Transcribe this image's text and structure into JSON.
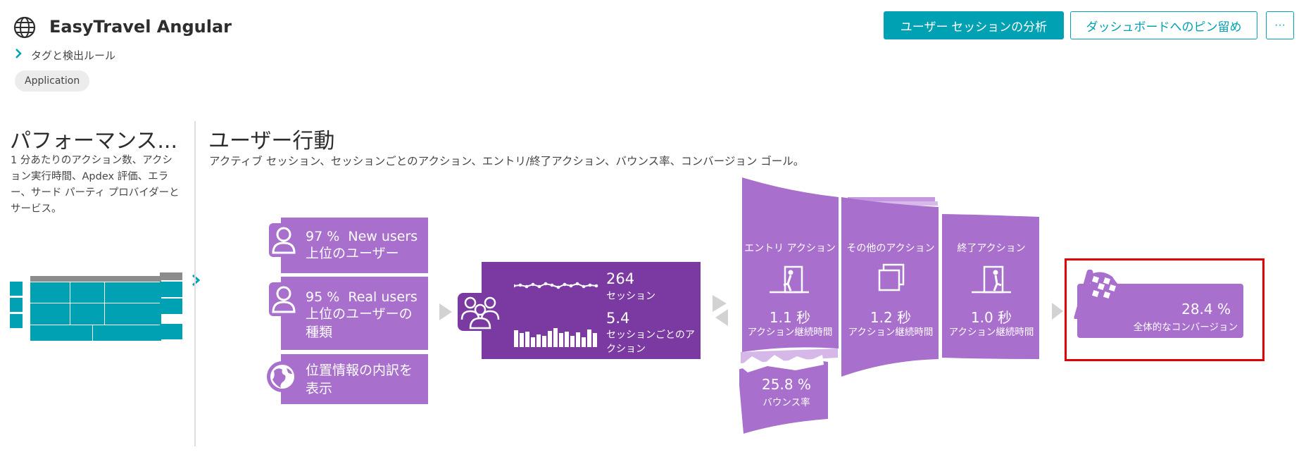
{
  "header": {
    "app_title": "EasyTravel Angular",
    "breadcrumb": "タグと検出ルール",
    "tag": "Application",
    "buttons": {
      "analyze": "ユーザー セッションの分析",
      "pin": "ダッシュボードへのピン留め",
      "more": "···"
    }
  },
  "performance": {
    "title": "パフォーマンス...",
    "description": "1 分あたりのアクション数、アクション実行時間、Apdex 評価、エラー、サード パーティ プロバイダーとサービス。"
  },
  "user_behavior": {
    "title": "ユーザー行動",
    "description": "アクティブ セッション、セッションごとのアクション、エントリ/終了アクション、バウンス率、コンバージョン ゴール。",
    "new_users": {
      "value": "97 %",
      "type": "New users",
      "label": "上位のユーザー"
    },
    "real_users": {
      "value": "95 %",
      "type": "Real users",
      "label": "上位のユーザーの種類"
    },
    "geo": {
      "label": "位置情報の内訳を表示"
    },
    "sessions": {
      "value": "264",
      "label": "セッション"
    },
    "actions_per_session": {
      "value": "5.4",
      "label": "セッションごとのアクション"
    },
    "entry": {
      "title": "エントリ アクション",
      "value": "1.1 秒",
      "label": "アクション継続時間"
    },
    "other": {
      "title": "その他のアクション",
      "value": "1.2 秒",
      "label": "アクション継続時間"
    },
    "exit": {
      "title": "終了アクション",
      "value": "1.0 秒",
      "label": "アクション継続時間"
    },
    "bounce": {
      "value": "25.8 %",
      "label": "バウンス率"
    },
    "conversion": {
      "value": "28.4 %",
      "label": "全体的なコンバージョン"
    }
  },
  "colors": {
    "accent": "#00a1b2",
    "purple_light": "#a86fcd",
    "purple_dark": "#7b3aa1",
    "highlight": "#e00000"
  }
}
